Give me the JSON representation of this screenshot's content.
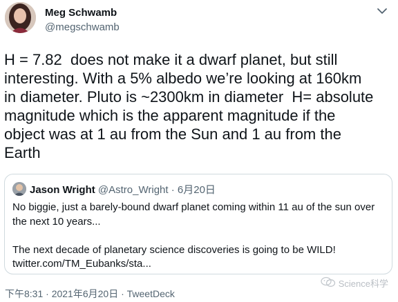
{
  "tweet": {
    "author_name": "Meg Schwamb",
    "author_handle": "@megschwamb",
    "text": "H = 7.82  does not make it a dwarf planet, but still\ninteresting. With a 5% albedo we’re looking at 160km\nin diameter. Pluto is ~2300km in diameter  H= absolute\nmagnitude which is the apparent magnitude if the\nobject was at 1 au from the Sun and 1 au from the\nEarth",
    "footer": "下午8:31 · 2021年6月20日 · TweetDeck"
  },
  "quoted_tweet": {
    "author_name": "Jason Wright",
    "meta": "@Astro_Wright · 6月20日",
    "text": "No biggie, just a barely-bound dwarf planet coming within 11 au of the sun over\nthe next 10 years...\n\nThe next decade of planetary science discoveries is going to be WILD!\ntwitter.com/TM_Eubanks/sta..."
  },
  "watermark": {
    "text": "Science科学"
  },
  "icons": {
    "more": "chevron-down-icon",
    "watermark": "wechat-icon"
  },
  "colors": {
    "text": "#0f1419",
    "secondary": "#536471",
    "border": "#cfd9de"
  }
}
